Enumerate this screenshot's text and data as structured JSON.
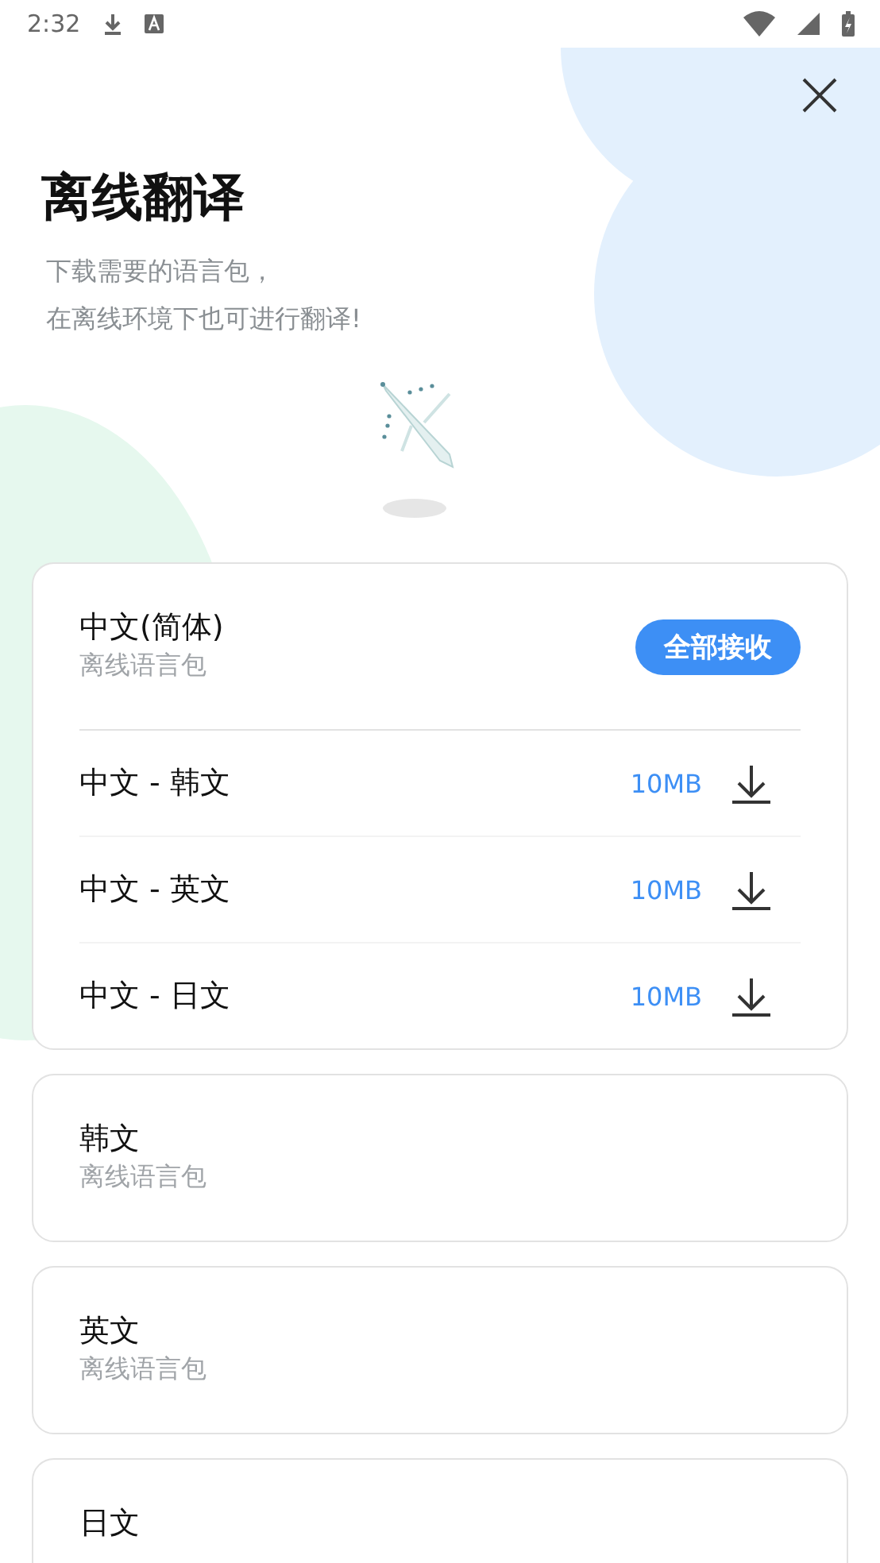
{
  "status_bar": {
    "time": "2:32"
  },
  "header": {
    "title": "离线翻译",
    "subtitle_lines": [
      "下载需要的语言包，",
      "在离线环境下也可进行翻译!"
    ]
  },
  "packs": [
    {
      "title": "中文(简体)",
      "subtitle": "离线语言包",
      "action": "全部接收",
      "pairs": [
        {
          "label": "中文 - 韩文",
          "size": "10MB"
        },
        {
          "label": "中文 - 英文",
          "size": "10MB"
        },
        {
          "label": "中文 - 日文",
          "size": "10MB"
        }
      ]
    },
    {
      "title": "韩文",
      "subtitle": "离线语言包"
    },
    {
      "title": "英文",
      "subtitle": "离线语言包"
    },
    {
      "title": "日文"
    }
  ]
}
